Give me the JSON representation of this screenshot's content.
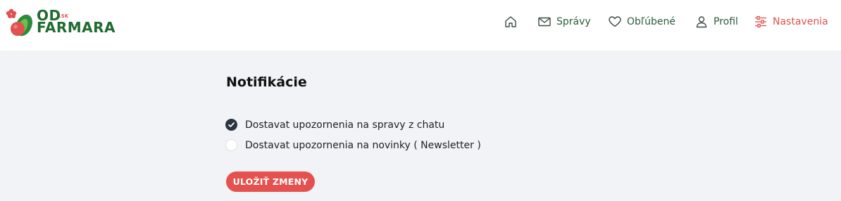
{
  "logo": {
    "od": "OD",
    "sk": ".SK",
    "farmara": "FARMARA"
  },
  "nav": {
    "home_icon": "home-icon",
    "messages": {
      "icon": "envelope-icon",
      "label": "Správy"
    },
    "favorites": {
      "icon": "heart-icon",
      "label": "Obľúbené"
    },
    "profile": {
      "icon": "user-icon",
      "label": "Profil"
    },
    "settings": {
      "icon": "sliders-icon",
      "label": "Nastavenia",
      "active": true
    }
  },
  "main": {
    "title": "Notifikácie",
    "options": [
      {
        "label": "Dostavat upozornenia na spravy z chatu",
        "checked": true
      },
      {
        "label": "Dostavat upozornenia na novinky ( Newsletter )",
        "checked": false
      }
    ],
    "save_label": "ULOŽIŤ ZMENY"
  },
  "colors": {
    "brand_green": "#1f6b30",
    "accent_red": "#e4514e",
    "background": "#f1f3f6",
    "header": "#ffffff",
    "checkbox_checked": "#2b3440"
  }
}
